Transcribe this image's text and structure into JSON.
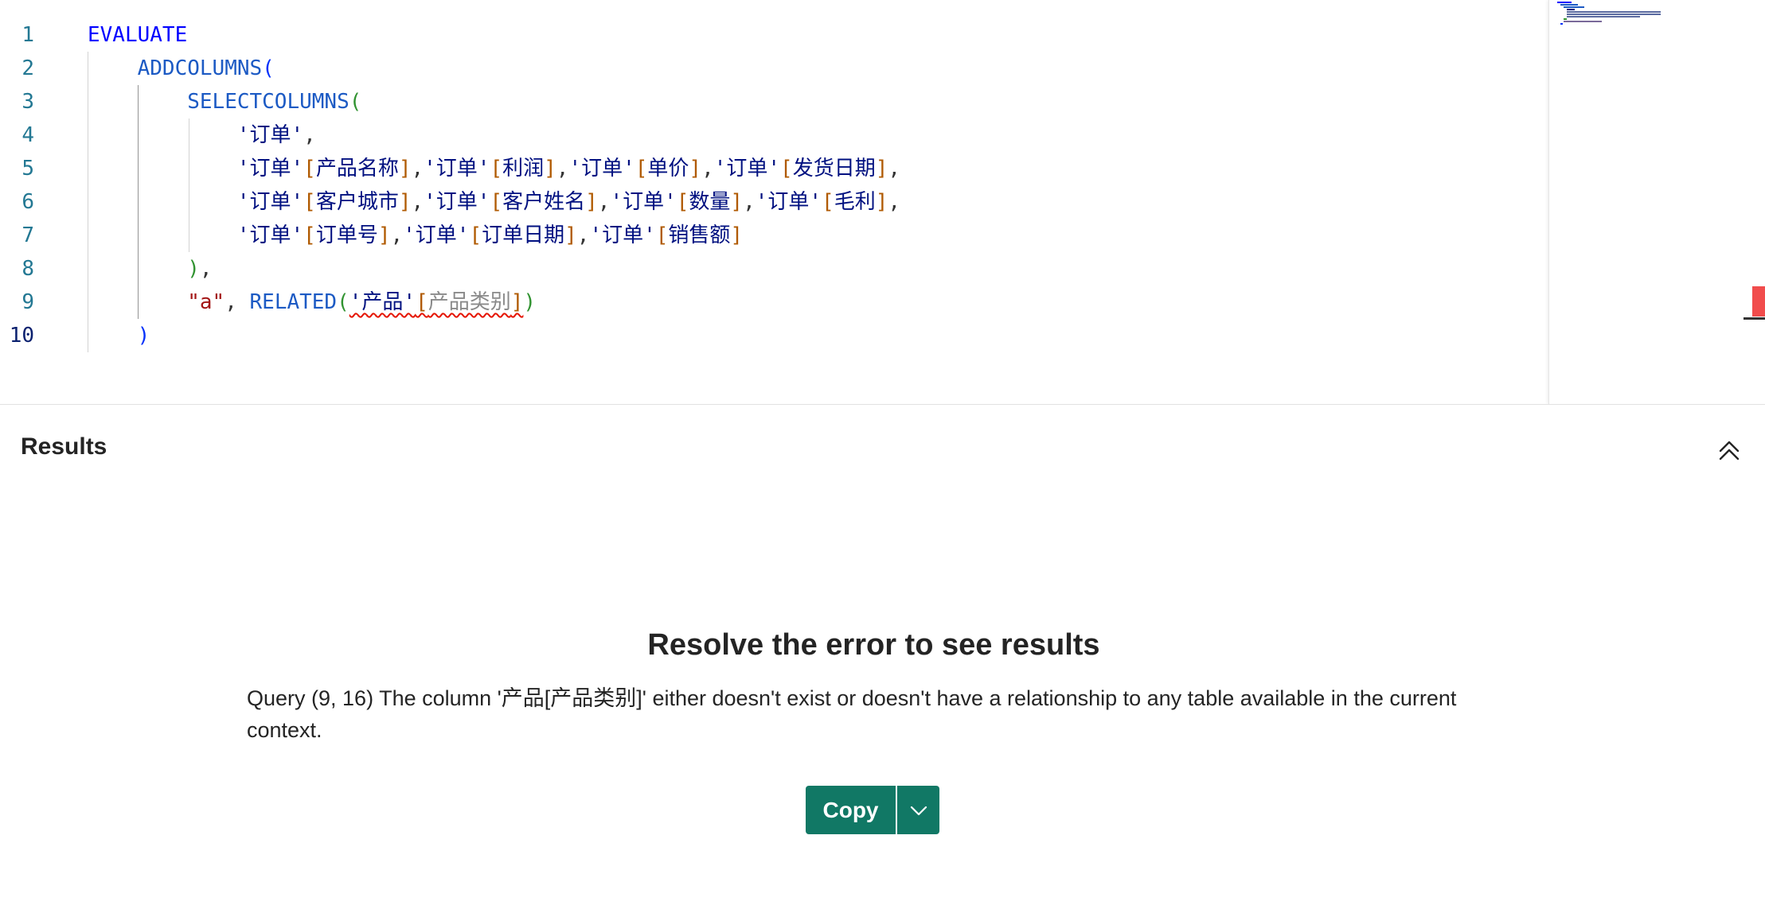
{
  "editor": {
    "line_numbers": [
      "1",
      "2",
      "3",
      "4",
      "5",
      "6",
      "7",
      "8",
      "9",
      "10"
    ],
    "code": {
      "l1": {
        "kw": "EVALUATE"
      },
      "l2": {
        "fn": "ADDCOLUMNS",
        "open": "("
      },
      "l3": {
        "fn": "SELECTCOLUMNS",
        "open": "("
      },
      "l4": {
        "tbl": "'订单'",
        "comma": ","
      },
      "l5": {
        "t1": "'订单'",
        "c1": "产品名称",
        "t2": "'订单'",
        "c2": "利润",
        "t3": "'订单'",
        "c3": "单价",
        "t4": "'订单'",
        "c4": "发货日期"
      },
      "l6": {
        "t1": "'订单'",
        "c1": "客户城市",
        "t2": "'订单'",
        "c2": "客户姓名",
        "t3": "'订单'",
        "c3": "数量",
        "t4": "'订单'",
        "c4": "毛利"
      },
      "l7": {
        "t1": "'订单'",
        "c1": "订单号",
        "t2": "'订单'",
        "c2": "订单日期",
        "t3": "'订单'",
        "c3": "销售额"
      },
      "l8": {
        "close": ")",
        "comma": ","
      },
      "l9": {
        "str": "\"a\"",
        "sep": ", ",
        "fn": "RELATED",
        "open": "(",
        "tbl": "'产品'",
        "col": "产品类别",
        "close": ")"
      },
      "l10": {
        "close": ")"
      }
    }
  },
  "results": {
    "title": "Results",
    "error_heading": "Resolve the error to see results",
    "error_message": "Query (9, 16) The column '产品[产品类别]' either doesn't exist or doesn't have a relationship to any table available in the current context.",
    "copy_label": "Copy"
  },
  "icons": {
    "collapse": "chevron-double-up-icon",
    "copy_menu": "chevron-down-icon"
  },
  "colors": {
    "accent": "#117865",
    "error": "#e51400",
    "line_number": "#237893"
  }
}
